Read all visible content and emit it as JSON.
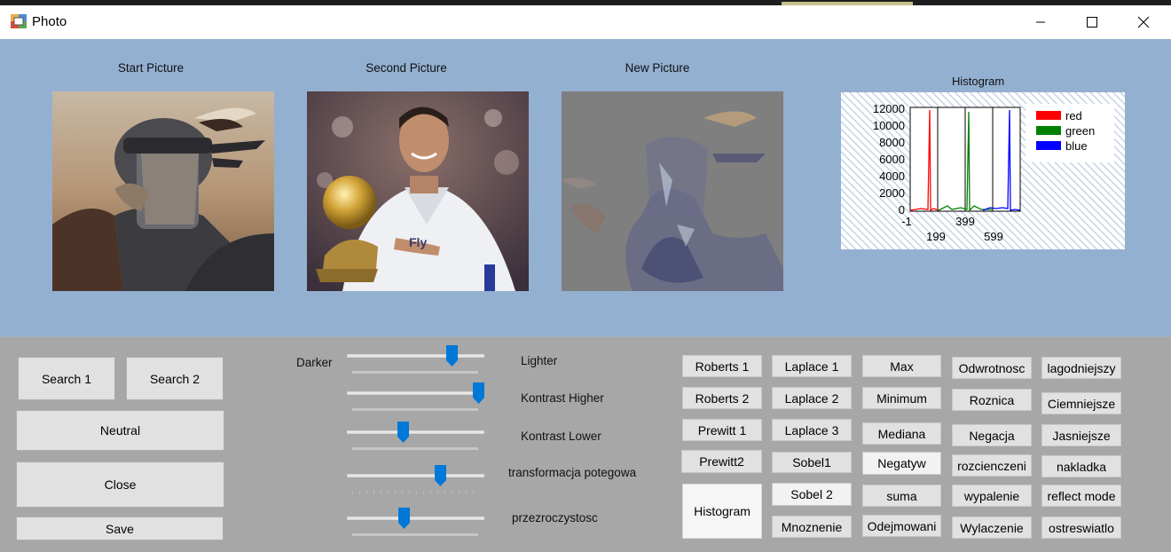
{
  "code_strip": {
    "text": ""
  },
  "window": {
    "title": "Photo",
    "controls": {
      "minimize": "minimize",
      "maximize": "maximize",
      "close": "close"
    }
  },
  "pictures": {
    "start": {
      "label": "Start Picture"
    },
    "second": {
      "label": "Second Picture"
    },
    "new": {
      "label": "New Picture"
    }
  },
  "histogram": {
    "title": "Histogram",
    "legend": [
      {
        "name": "red",
        "color": "#ff0000"
      },
      {
        "name": "green",
        "color": "#008000"
      },
      {
        "name": "blue",
        "color": "#0000ff"
      }
    ],
    "y_ticks": [
      "12000",
      "10000",
      "8000",
      "6000",
      "4000",
      "2000",
      "0"
    ],
    "x_ticks_top": [
      "-1",
      "399"
    ],
    "x_ticks_bottom": [
      "199",
      "599"
    ]
  },
  "left_buttons": {
    "search1": "Search 1",
    "search2": "Search 2",
    "neutral": "Neutral",
    "close": "Close",
    "save": "Save"
  },
  "sliders": {
    "darker_label": "Darker",
    "lighter_label": "Lighter",
    "kontrast_higher": "Kontrast Higher",
    "kontrast_lower": "Kontrast Lower",
    "transformacja": "transformacja potegowa",
    "przezroczystosc": "przezroczystosc",
    "values": {
      "brightness": 0.79,
      "kontrast_higher": 1.0,
      "kontrast_lower": 0.4,
      "transformacja": 0.7,
      "przezroczystosc": 0.41
    }
  },
  "filters": {
    "col1": [
      "Roberts 1",
      "Roberts 2",
      "Prewitt 1",
      "Prewitt2",
      "Histogram"
    ],
    "col2": [
      "Laplace 1",
      "Laplace 2",
      "Laplace 3",
      "Sobel1",
      "Sobel 2",
      "Mnoznenie"
    ],
    "col3": [
      "Max",
      "Minimum",
      "Mediana",
      "Negatyw",
      "suma",
      "Odejmowani"
    ],
    "col4": [
      "Odwrotnosc",
      "Roznica",
      "Negacja",
      "rozcienczeni",
      "wypalenie",
      "Wylaczenie"
    ],
    "col5": [
      "lagodniejszy",
      "Ciemniejsze",
      "Jasniejsze",
      "nakladka",
      "reflect mode",
      "ostreswiatlo"
    ]
  }
}
